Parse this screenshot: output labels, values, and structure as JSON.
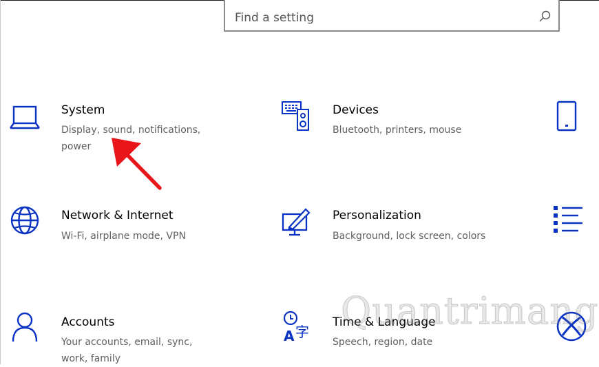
{
  "search": {
    "placeholder": "Find a setting"
  },
  "accent_color": "#0a33c4",
  "annotation_color": "#e8151b",
  "tiles": [
    {
      "title": "System",
      "desc_line1": "Display, sound, notifications,",
      "desc_line2": "power",
      "icon": "laptop-icon"
    },
    {
      "title": "Devices",
      "desc_line1": "Bluetooth, printers, mouse",
      "icon": "devices-icon"
    },
    {
      "title": "Network & Internet",
      "desc_line1": "Wi-Fi, airplane mode, VPN",
      "icon": "globe-icon"
    },
    {
      "title": "Personalization",
      "desc_line1": "Background, lock screen, colors",
      "icon": "personalization-icon"
    },
    {
      "title": "Accounts",
      "desc_line1": "Your accounts, email, sync,",
      "desc_line2": "work, family",
      "icon": "person-icon"
    },
    {
      "title": "Time & Language",
      "desc_line1": "Speech, region, date",
      "icon": "time-language-icon"
    }
  ],
  "right_column_icons": [
    "phone-icon",
    "apps-list-icon",
    "xbox-icon"
  ],
  "watermark": {
    "text": "Quantrimang"
  }
}
